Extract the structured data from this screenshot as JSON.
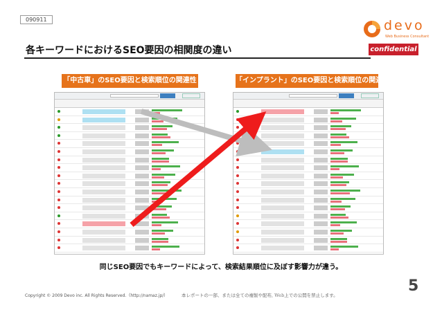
{
  "slide_id": "090911",
  "logo": {
    "word": "devo",
    "tagline": "Web Business Consultant",
    "color": "#e86c1a"
  },
  "title": "各キーワードにおけるSEO要因の相関度の違い",
  "confidential_label": "confidential",
  "panels": {
    "left_title": "「中古車」のSEO要因と検索順位の関連性",
    "right_title": "「インプラント」のSEO要因と検索順位の関連性"
  },
  "caption": "同じSEO要因でもキーワードによって、検索結果順位に及ぼす影響力が違う。",
  "footer": {
    "copyright": "Copyright © 2009 Devo inc. All Rights Reserved.（http://namaz.jp/）",
    "notice": "本レポートの一部、または全ての複製や配布, Web上での公開を禁止します。"
  },
  "page_number": "5",
  "colors": {
    "accent": "#e6731b",
    "confidential": "#c8202c",
    "arrow_red": "#ee1c1c",
    "arrow_gray": "#bdbdbd"
  }
}
